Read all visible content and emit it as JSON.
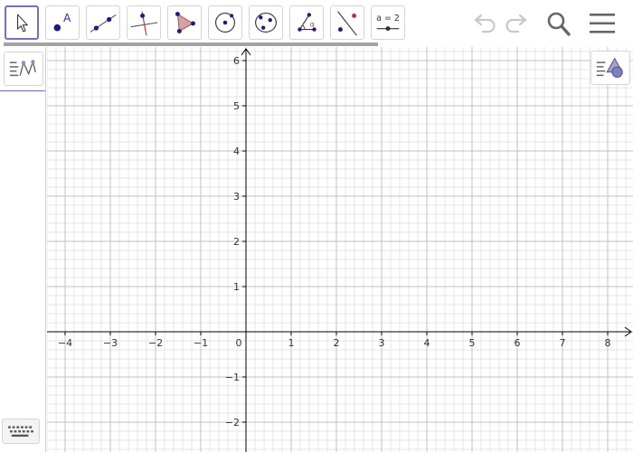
{
  "toolbar": {
    "tools": [
      {
        "name": "move-tool",
        "icon": "cursor-arrow-icon",
        "selected": true
      },
      {
        "name": "point-tool",
        "icon": "point-icon",
        "label": "A"
      },
      {
        "name": "line-tool",
        "icon": "line-through-points-icon"
      },
      {
        "name": "perpendicular-line-tool",
        "icon": "perpendicular-line-icon"
      },
      {
        "name": "polygon-tool",
        "icon": "polygon-icon"
      },
      {
        "name": "circle-tool",
        "icon": "circle-center-point-icon"
      },
      {
        "name": "ellipse-tool",
        "icon": "circle-three-points-icon"
      },
      {
        "name": "angle-tool",
        "icon": "angle-icon",
        "label": "α"
      },
      {
        "name": "reflect-tool",
        "icon": "reflect-about-line-icon"
      },
      {
        "name": "slider-tool",
        "icon": "slider-icon",
        "label": "a = 2"
      }
    ],
    "actions": [
      {
        "name": "undo-button",
        "icon": "undo-icon"
      },
      {
        "name": "redo-button",
        "icon": "redo-icon"
      },
      {
        "name": "search-button",
        "icon": "search-icon"
      },
      {
        "name": "menu-button",
        "icon": "hamburger-menu-icon"
      }
    ]
  },
  "left_panel": {
    "tab_icon": "algebra-view-icon",
    "keyboard_icon": "keyboard-icon"
  },
  "graphics": {
    "style_bar_icon": "graphics-style-bar-icon",
    "axis_color": "#000000",
    "major_grid_color": "#c0c0c0",
    "minor_grid_color": "#e6e6e6",
    "x_ticks": [
      "−4",
      "−3",
      "−2",
      "−1",
      "0",
      "1",
      "2",
      "3",
      "4",
      "5",
      "6",
      "7",
      "8"
    ],
    "x_tick_values": [
      -4,
      -3,
      -2,
      -1,
      0,
      1,
      2,
      3,
      4,
      5,
      6,
      7,
      8
    ],
    "y_ticks": [
      "6",
      "5",
      "4",
      "3",
      "2",
      "1",
      "−1",
      "−2"
    ],
    "y_tick_values": [
      6,
      5,
      4,
      3,
      2,
      1,
      -1,
      -2
    ],
    "grid": true
  },
  "colors": {
    "accent": "#6f6fd1",
    "point": "#1a1a8c",
    "polygon_fill": "#d9a0a0"
  }
}
